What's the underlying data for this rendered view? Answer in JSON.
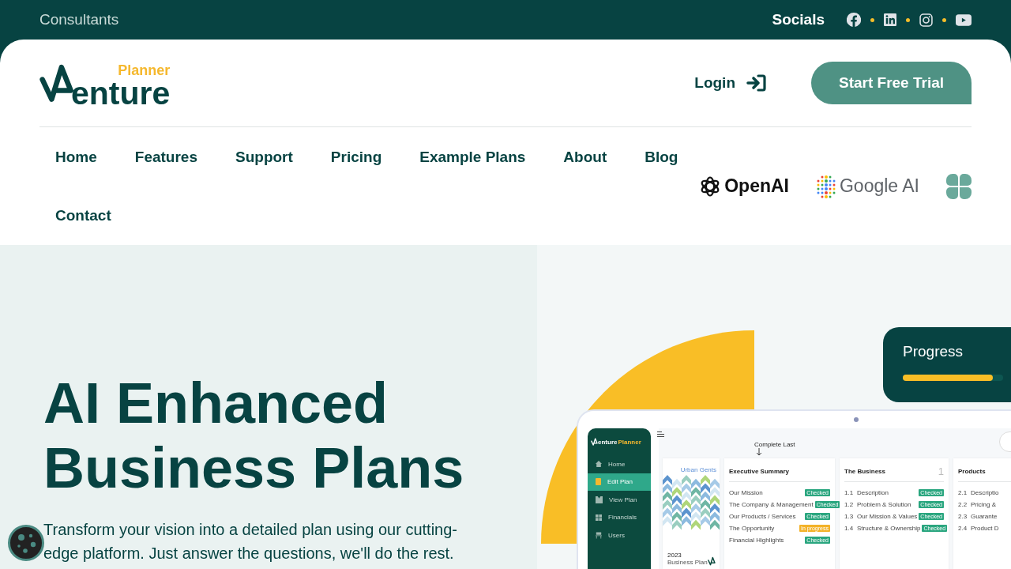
{
  "top_bar": {
    "label": "Consultants",
    "socials_label": "Socials",
    "socials": [
      {
        "kind": "facebook"
      },
      {
        "kind": "linkedin"
      },
      {
        "kind": "instagram"
      },
      {
        "kind": "youtube"
      }
    ]
  },
  "header": {
    "logo": {
      "accent": "Planner",
      "word": "enture"
    },
    "login": "Login",
    "cta": "Start Free Trial"
  },
  "nav": [
    {
      "label": "Home"
    },
    {
      "label": "Features"
    },
    {
      "label": "Support"
    },
    {
      "label": "Pricing"
    },
    {
      "label": "Example Plans"
    },
    {
      "label": "About"
    },
    {
      "label": "Blog"
    },
    {
      "label": "Contact"
    }
  ],
  "partners": [
    {
      "kind": "openai",
      "label": "OpenAI"
    },
    {
      "kind": "google",
      "label": "Google AI"
    },
    {
      "kind": "clover"
    }
  ],
  "hero": {
    "title_lines": [
      "AI Enhanced",
      "Business Plans"
    ],
    "text": "Transform your vision into a detailed plan using our cutting-edge platform. Just answer the questions, we'll do the rest."
  },
  "progress": {
    "label": "Progress",
    "level": 0.9
  },
  "app_preview": {
    "brand": {
      "word": "enture",
      "accent": "Planner"
    },
    "menu": [
      {
        "label": "Home",
        "selected": false
      },
      {
        "label": "Edit Plan",
        "selected": true
      },
      {
        "label": "View Plan",
        "selected": false
      },
      {
        "label": "Financials",
        "selected": false
      },
      {
        "label": "Users",
        "selected": false
      }
    ],
    "note": "Complete Last",
    "cover": {
      "title": "Urban Gents",
      "year": "2023",
      "subtitle": "Business Plan"
    },
    "sections": [
      {
        "title": "Executive Summary",
        "items": [
          {
            "label": "Our Mission",
            "status": "Checked",
            "kind": "done"
          },
          {
            "label": "The Company & Management",
            "status": "Checked",
            "kind": "done"
          },
          {
            "label": "Our Products / Services",
            "status": "Checked",
            "kind": "done"
          },
          {
            "label": "The Opportunity",
            "status": "In progress",
            "kind": "progress"
          },
          {
            "label": "Financial Highlights",
            "status": "Checked",
            "kind": "done"
          }
        ]
      },
      {
        "title": "The Business",
        "number": "1",
        "items": [
          {
            "number": "1.1",
            "label": "Description",
            "status": "Checked",
            "kind": "done"
          },
          {
            "number": "1.2",
            "label": "Problem & Solution",
            "status": "Checked",
            "kind": "done"
          },
          {
            "number": "1.3",
            "label": "Our Mission & Values",
            "status": "Checked",
            "kind": "done"
          },
          {
            "number": "1.4",
            "label": "Structure & Ownership",
            "status": "Checked",
            "kind": "done"
          }
        ]
      },
      {
        "title": "Products",
        "items": [
          {
            "number": "2.1",
            "label": "Descriptio"
          },
          {
            "number": "2.2",
            "label": "Pricing &"
          },
          {
            "number": "2.3",
            "label": "Guarante"
          },
          {
            "number": "2.4",
            "label": "Product D"
          }
        ]
      }
    ]
  }
}
